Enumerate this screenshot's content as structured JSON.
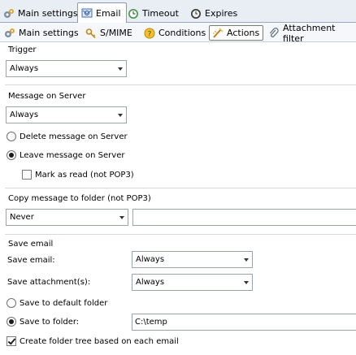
{
  "tabs_main": [
    {
      "label": "Main settings",
      "icon": "main-settings-icon"
    },
    {
      "label": "Email",
      "icon": "email-icon"
    },
    {
      "label": "Timeout",
      "icon": "timeout-icon"
    },
    {
      "label": "Expires",
      "icon": "expires-icon"
    }
  ],
  "tabs_sub": [
    {
      "label": "Main settings",
      "icon": "main-settings-icon"
    },
    {
      "label": "S/MIME",
      "icon": "smime-icon"
    },
    {
      "label": "Conditions",
      "icon": "conditions-icon"
    },
    {
      "label": "Actions",
      "icon": "actions-icon"
    },
    {
      "label": "Attachment filter",
      "icon": "attachment-icon"
    }
  ],
  "trigger": {
    "label": "Trigger",
    "value": "Always"
  },
  "message_on_server": {
    "label": "Message on Server",
    "value": "Always",
    "delete_label": "Delete message on Server",
    "leave_label": "Leave message on Server",
    "mark_read_label": "Mark as read (not POP3)"
  },
  "copy_folder": {
    "label": "Copy message to folder (not POP3)",
    "value": "Never",
    "folder": ""
  },
  "save_email": {
    "label": "Save email",
    "save_email_label": "Save email:",
    "save_email_value": "Always",
    "save_attach_label": "Save attachment(s):",
    "save_attach_value": "Always",
    "default_folder_label": "Save to default folder",
    "save_to_folder_label": "Save to folder:",
    "save_to_folder_value": "C:\\temp",
    "create_tree_label": "Create folder tree based on each email"
  }
}
